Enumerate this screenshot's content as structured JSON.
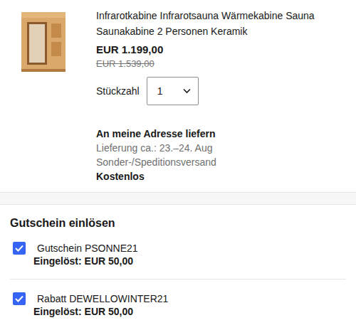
{
  "product": {
    "title": "Infrarotkabine Infrarotsauna Wärmekabine Sauna Saunakabine 2 Personen Keramik",
    "price": "EUR 1.199,00",
    "original_price": "EUR 1.539,00",
    "quantity_label": "Stückzahl",
    "quantity": "1"
  },
  "delivery": {
    "title": "An meine Adresse liefern",
    "date": "Lieferung ca.: 23.–24. Aug",
    "method": "Sonder-/Speditionsversand",
    "cost": "Kostenlos"
  },
  "coupons": {
    "title": "Gutschein einlösen",
    "items": [
      {
        "label": "Gutschein PSONNE21",
        "applied": "Eingelöst: EUR 50,00",
        "checked": true
      },
      {
        "label": "Rabatt DEWELLOWINTER21",
        "applied": "Eingelöst: EUR 50,00",
        "checked": true
      }
    ]
  }
}
